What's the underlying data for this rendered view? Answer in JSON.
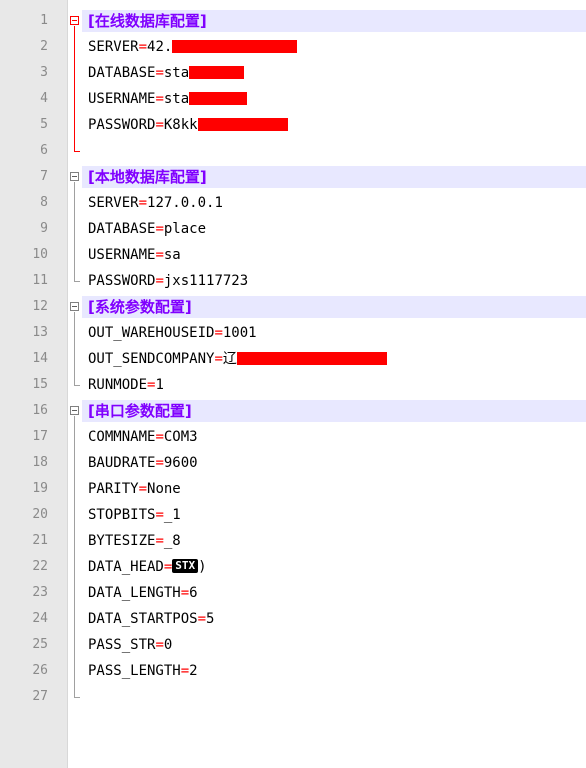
{
  "editor": {
    "lines": [
      {
        "n": "1",
        "type": "section",
        "text": "[在线数据库配置]"
      },
      {
        "n": "2",
        "type": "kv",
        "key": "SERVER",
        "value": "42.",
        "redact": 125
      },
      {
        "n": "3",
        "type": "kv",
        "key": "DATABASE",
        "value": "sta",
        "redact": 55
      },
      {
        "n": "4",
        "type": "kv",
        "key": "USERNAME",
        "value": "sta",
        "redact": 58
      },
      {
        "n": "5",
        "type": "kv",
        "key": "PASSWORD",
        "value": "K8kk",
        "redact": 90
      },
      {
        "n": "6",
        "type": "empty"
      },
      {
        "n": "7",
        "type": "section",
        "text": "[本地数据库配置]"
      },
      {
        "n": "8",
        "type": "kv",
        "key": "SERVER",
        "value": "127.0.0.1"
      },
      {
        "n": "9",
        "type": "kv",
        "key": "DATABASE",
        "value": "place"
      },
      {
        "n": "10",
        "type": "kv",
        "key": "USERNAME",
        "value": "sa"
      },
      {
        "n": "11",
        "type": "kv",
        "key": "PASSWORD",
        "value": "jxs1117723"
      },
      {
        "n": "12",
        "type": "section",
        "text": "[系统参数配置]"
      },
      {
        "n": "13",
        "type": "kv",
        "key": "OUT_WAREHOUSEID",
        "value": "1001"
      },
      {
        "n": "14",
        "type": "kv",
        "key": "OUT_SENDCOMPANY",
        "value": "辽",
        "redact": 150
      },
      {
        "n": "15",
        "type": "kv",
        "key": "RUNMODE",
        "value": "1"
      },
      {
        "n": "16",
        "type": "section",
        "text": "[串口参数配置]"
      },
      {
        "n": "17",
        "type": "kv",
        "key": "COMMNAME",
        "value": "COM3"
      },
      {
        "n": "18",
        "type": "kv",
        "key": "BAUDRATE",
        "value": "9600"
      },
      {
        "n": "19",
        "type": "kv",
        "key": "PARITY",
        "value": "None"
      },
      {
        "n": "20",
        "type": "kv",
        "key": "STOPBITS",
        "value": "_1"
      },
      {
        "n": "21",
        "type": "kv",
        "key": "BYTESIZE",
        "value": "_8"
      },
      {
        "n": "22",
        "type": "kv",
        "key": "DATA_HEAD",
        "value": "",
        "badge": "STX",
        "suffix": ")"
      },
      {
        "n": "23",
        "type": "kv",
        "key": "DATA_LENGTH",
        "value": "6"
      },
      {
        "n": "24",
        "type": "kv",
        "key": "DATA_STARTPOS",
        "value": "5"
      },
      {
        "n": "25",
        "type": "kv",
        "key": "PASS_STR",
        "value": "0"
      },
      {
        "n": "26",
        "type": "kv",
        "key": "PASS_LENGTH",
        "value": "2"
      },
      {
        "n": "27",
        "type": "empty"
      }
    ],
    "equals_sign": "="
  },
  "colors": {
    "section_text": "#8000ff",
    "section_bg": "#e8e8ff",
    "equals": "#ff0000",
    "redaction": "#ff0000",
    "line_number": "#8a8a8a"
  }
}
